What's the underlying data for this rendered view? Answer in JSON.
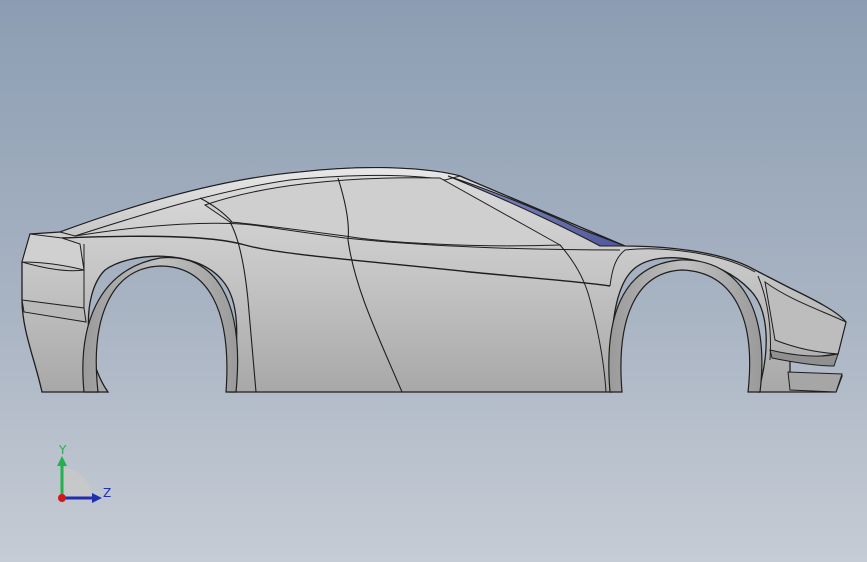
{
  "viewport": {
    "background_top": "#8c9db3",
    "background_bottom": "#c6ccd5",
    "model": {
      "name": "car-body-side-view",
      "body_color": "#c8c8c8",
      "edge_color": "#1e1e1e",
      "glass_color": "#6a72a8"
    }
  },
  "triad": {
    "y_label": "Y",
    "z_label": "Z",
    "y_color": "#22b14c",
    "z_color": "#1f2fb0",
    "origin_color": "#d01818"
  }
}
